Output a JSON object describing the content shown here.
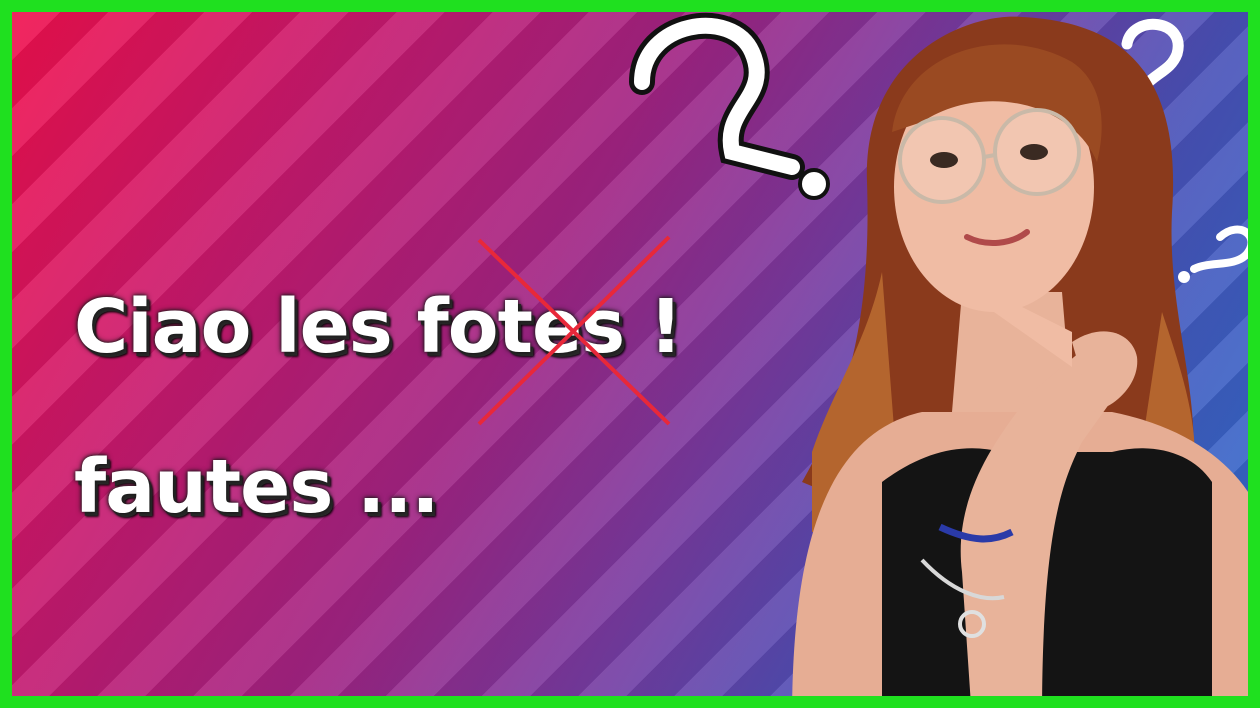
{
  "headline": {
    "line1": "Ciao les fotes !",
    "line2": "fautes ..."
  },
  "colors": {
    "border": "#1fe01f",
    "cross": "#e8283a",
    "text": "#ffffff"
  }
}
